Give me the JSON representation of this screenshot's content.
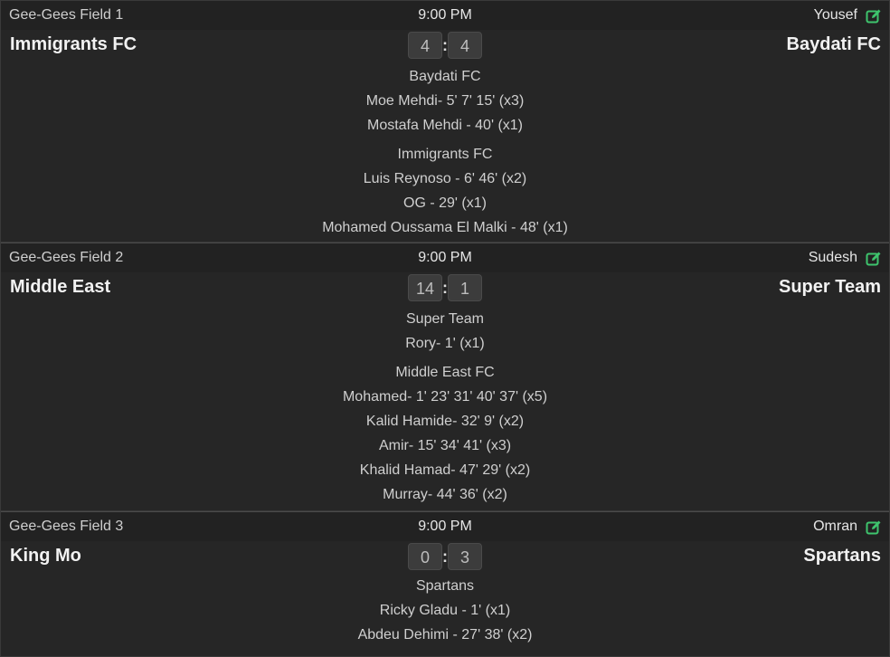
{
  "matches": [
    {
      "field": "Gee-Gees Field 1",
      "time": "9:00 PM",
      "referee": "Yousef",
      "home_team": "Immigrants FC",
      "away_team": "Baydati FC",
      "home_score": "4",
      "away_score": "4",
      "scorer_groups": [
        {
          "team": "Baydati FC",
          "scorers": [
            "Moe Mehdi- 5' 7' 15' (x3)",
            "Mostafa Mehdi - 40' (x1)"
          ]
        },
        {
          "team": "Immigrants FC",
          "scorers": [
            "Luis Reynoso - 6' 46' (x2)",
            "OG - 29' (x1)",
            "Mohamed Oussama El Malki - 48' (x1)"
          ]
        }
      ]
    },
    {
      "field": "Gee-Gees Field 2",
      "time": "9:00 PM",
      "referee": "Sudesh",
      "home_team": "Middle East",
      "away_team": "Super Team",
      "home_score": "14",
      "away_score": "1",
      "scorer_groups": [
        {
          "team": "Super Team",
          "scorers": [
            "Rory- 1' (x1)"
          ]
        },
        {
          "team": "Middle East FC",
          "scorers": [
            "Mohamed- 1' 23' 31' 40' 37' (x5)",
            "Kalid Hamide- 32' 9' (x2)",
            "Amir- 15' 34' 41' (x3)",
            "Khalid Hamad- 47' 29' (x2)",
            "Murray- 44' 36' (x2)"
          ]
        }
      ]
    },
    {
      "field": "Gee-Gees Field 3",
      "time": "9:00 PM",
      "referee": "Omran",
      "home_team": "King Mo",
      "away_team": "Spartans",
      "home_score": "0",
      "away_score": "3",
      "scorer_groups": [
        {
          "team": "Spartans",
          "scorers": [
            "Ricky Gladu - 1' (x1)",
            "Abdeu Dehimi - 27' 38' (x2)"
          ]
        }
      ]
    }
  ],
  "colors": {
    "background": "#262626",
    "header_bar": "#222222",
    "edit_icon": "#3ec46d",
    "score_box": "#3c3c3c"
  },
  "icons": {
    "edit": "edit-icon"
  }
}
